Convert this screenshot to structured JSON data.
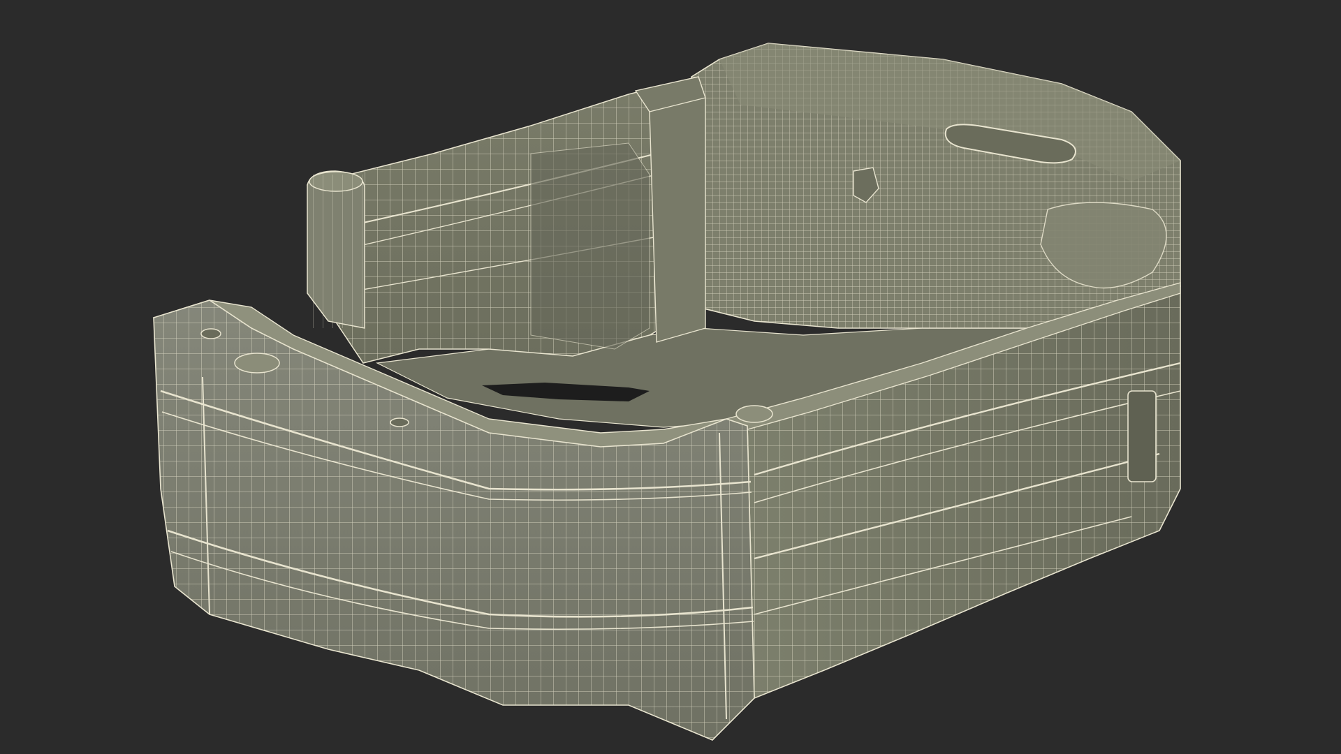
{
  "scene": {
    "subject": "wireframe-render-of-molded-collar-housing",
    "colors": {
      "background": "#2b2b2b",
      "surface": "#7b7e6b",
      "surface_dark": "#6a6c5b",
      "surface_light": "#8b8d79",
      "wire": "#e8e4cf",
      "interior": "#707260",
      "hole": "#1f1f1f"
    }
  }
}
